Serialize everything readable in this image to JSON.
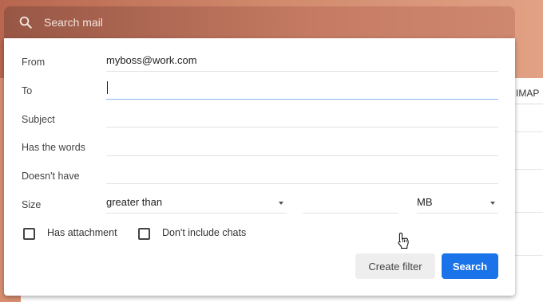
{
  "search": {
    "placeholder": "Search mail"
  },
  "background": {
    "tab_label": "IMAP"
  },
  "filter": {
    "from": {
      "label": "From",
      "value": "myboss@work.com"
    },
    "to": {
      "label": "To",
      "value": ""
    },
    "subject": {
      "label": "Subject",
      "value": ""
    },
    "has_words": {
      "label": "Has the words",
      "value": ""
    },
    "doesnt_have": {
      "label": "Doesn't have",
      "value": ""
    },
    "size": {
      "label": "Size",
      "comparator": "greater than",
      "amount": "",
      "unit": "MB"
    },
    "has_attachment": {
      "label": "Has attachment",
      "checked": false
    },
    "dont_include_chats": {
      "label": "Don't include chats",
      "checked": false
    },
    "create_filter_label": "Create filter",
    "search_label": "Search"
  },
  "colors": {
    "primary_button": "#1a73e8",
    "active_underline": "#8ab4f8"
  },
  "icons": [
    "search-icon",
    "dropdown-arrow-icon",
    "hand-pointer-icon"
  ]
}
